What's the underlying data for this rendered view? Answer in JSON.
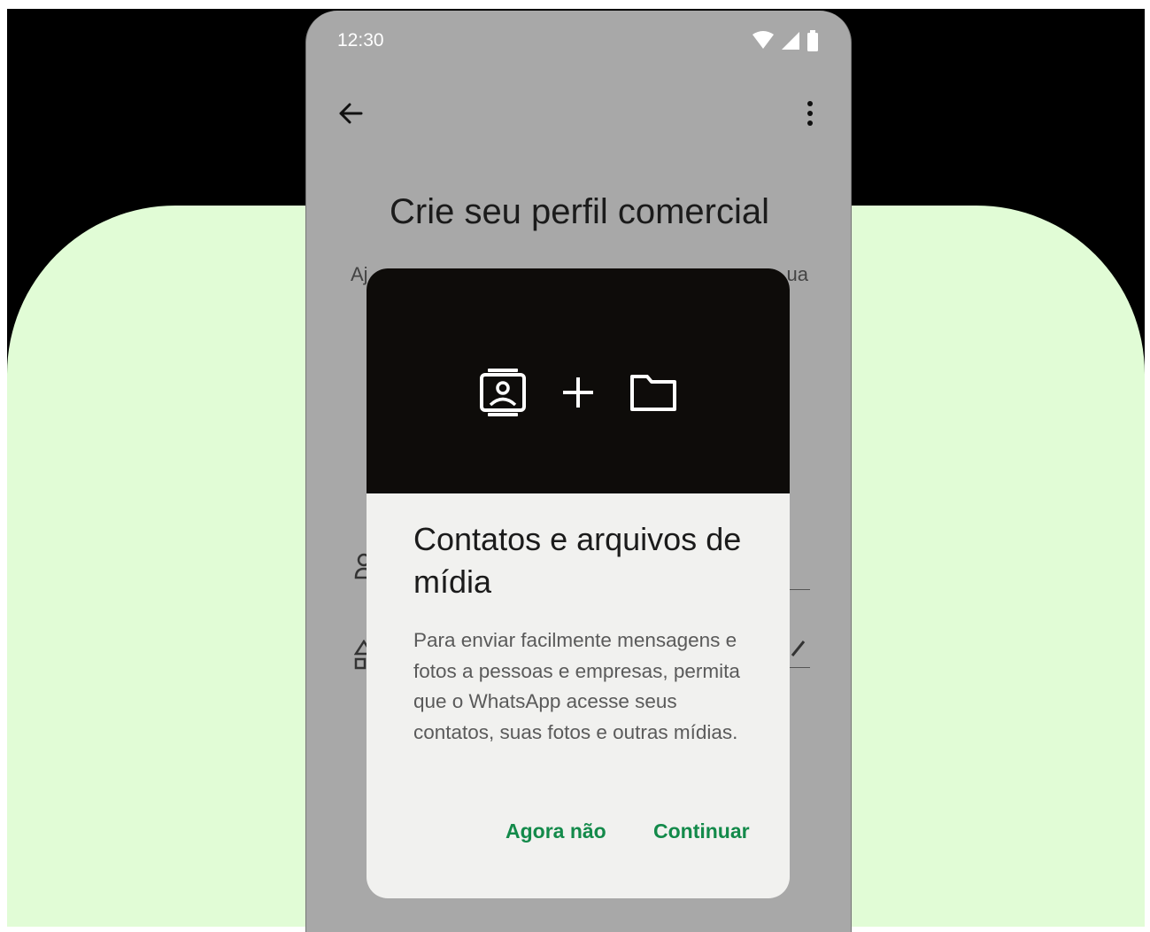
{
  "status_bar": {
    "time": "12:30"
  },
  "page": {
    "title": "Crie seu perfil comercial",
    "subtitle_start": "Aj",
    "subtitle_end": "ua"
  },
  "dialog": {
    "title": "Contatos e arquivos de mídia",
    "body": "Para enviar facilmente mensagens e fotos a pessoas e empresas, permita que o WhatsApp acesse seus contatos, suas fotos e outras mídias.",
    "buttons": {
      "later": "Agora não",
      "continue": "Continuar"
    },
    "header_icons": [
      "contacts-icon",
      "plus-icon",
      "folder-icon"
    ]
  },
  "colors": {
    "background_green": "#e1fcd6",
    "scrim": "#a8a8a8",
    "dialog_bg": "#f1f1ef",
    "dialog_header": "#0e0c0a",
    "accent": "#138a4a"
  }
}
